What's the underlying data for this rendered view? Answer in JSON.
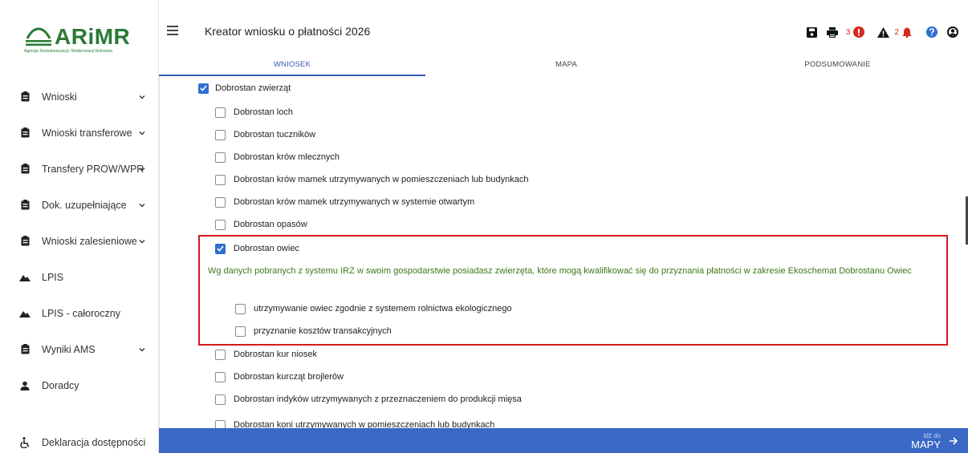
{
  "logo": {
    "name": "ARiMR",
    "subtitle": "Agencja Restrukturyzacji i Modernizacji Rolnictwa"
  },
  "sidebar": {
    "items": [
      {
        "label": "Wnioski",
        "icon": "clipboard-icon",
        "chevron": true
      },
      {
        "label": "Wnioski transferowe",
        "icon": "clipboard-icon",
        "chevron": true
      },
      {
        "label": "Transfery PROW/WPR",
        "icon": "clipboard-icon",
        "chevron": true
      },
      {
        "label": "Dok. uzupełniające",
        "icon": "clipboard-icon",
        "chevron": true
      },
      {
        "label": "Wnioski zalesieniowe",
        "icon": "clipboard-icon",
        "chevron": true
      },
      {
        "label": "LPIS",
        "icon": "mountain-icon",
        "chevron": false
      },
      {
        "label": "LPIS - całoroczny",
        "icon": "mountain-icon",
        "chevron": false
      },
      {
        "label": "Wyniki AMS",
        "icon": "clipboard-icon",
        "chevron": true
      },
      {
        "label": "Doradcy",
        "icon": "user-icon",
        "chevron": false
      }
    ],
    "bottom": {
      "label": "Deklaracja dostępności",
      "icon": "accessibility-icon"
    }
  },
  "header": {
    "title": "Kreator wniosku o płatności 2026",
    "errors_count": "3",
    "warnings_count": "2"
  },
  "tabs": [
    {
      "label": "WNIOSEK",
      "active": true
    },
    {
      "label": "MAPA",
      "active": false
    },
    {
      "label": "PODSUMOWANIE",
      "active": false
    }
  ],
  "form": {
    "group": {
      "label": "Dobrostan zwierząt",
      "checked": true
    },
    "items": [
      {
        "label": "Dobrostan loch",
        "checked": false
      },
      {
        "label": "Dobrostan tuczników",
        "checked": false
      },
      {
        "label": "Dobrostan krów mlecznych",
        "checked": false
      },
      {
        "label": "Dobrostan krów mamek utrzymywanych w pomieszczeniach lub budynkach",
        "checked": false
      },
      {
        "label": "Dobrostan krów mamek utrzymywanych w systemie otwartym",
        "checked": false
      },
      {
        "label": "Dobrostan opasów",
        "checked": false
      },
      {
        "label": "Dobrostan owiec",
        "checked": true
      }
    ],
    "info_text": "Wg danych pobranych z systemu IRZ w swoim gospodarstwie posiadasz zwierzęta, które mogą kwalifikować się do przyznania płatności w zakresie Ekoschemat Dobrostanu Owiec",
    "sub_items": [
      {
        "label": "utrzymywanie owiec zgodnie z systemem rolnictwa ekologicznego",
        "checked": false
      },
      {
        "label": "przyznanie kosztów transakcyjnych",
        "checked": false
      }
    ],
    "items_after": [
      {
        "label": "Dobrostan kur niosek",
        "checked": false
      },
      {
        "label": "Dobrostan kurcząt brojlerów",
        "checked": false
      },
      {
        "label": "Dobrostan indyków utrzymywanych z przeznaczeniem do produkcji mięsa",
        "checked": false
      },
      {
        "label": "Dobrostan koni utrzymywanych w pomieszczeniach lub budynkach",
        "checked": false
      }
    ]
  },
  "footer": {
    "small": "Idź do",
    "big": "MAPY"
  },
  "colors": {
    "accent": "#2f5cb7",
    "brand_green": "#2a7a36",
    "highlight_red": "#d7191a",
    "info_green": "#3b7a16",
    "footer_blue": "#3a68c6"
  }
}
